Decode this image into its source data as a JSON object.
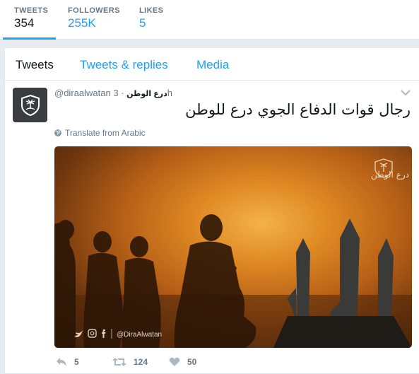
{
  "stats": {
    "tweets": {
      "label": "TWEETS",
      "value": "354"
    },
    "followers": {
      "label": "FOLLOWERS",
      "value": "255K"
    },
    "likes": {
      "label": "LIKES",
      "value": "5"
    }
  },
  "tabs": [
    {
      "label": "Tweets",
      "active": true
    },
    {
      "label": "Tweets & replies",
      "active": false
    },
    {
      "label": "Media",
      "active": false
    }
  ],
  "tweet": {
    "name": "درع الوطن",
    "handle": "@diraalwatan",
    "separator": "·",
    "time": "3h",
    "text": "رجال قوات الدفاع الجوي درع للوطن",
    "translate": "Translate from Arabic",
    "media": {
      "watermark": "درع الوطن",
      "social_handle": "@DiraAlwatan"
    },
    "actions": {
      "replies": "5",
      "retweets": "124",
      "likes": "50"
    }
  },
  "colors": {
    "accent": "#1da1f2",
    "muted": "#657786",
    "background": "#e6ecf0"
  }
}
